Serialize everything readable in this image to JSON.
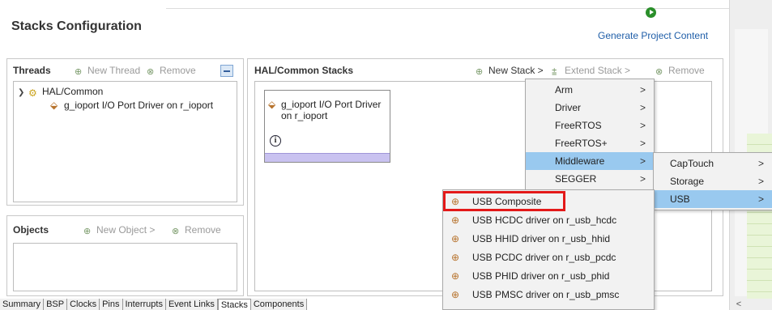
{
  "page": {
    "title": "Stacks Configuration"
  },
  "actions": {
    "generate_label": "Generate Project Content"
  },
  "threads": {
    "title": "Threads",
    "new_thread": "New Thread",
    "remove": "Remove",
    "tree": {
      "root": "HAL/Common",
      "child": "g_ioport I/O Port Driver on r_ioport"
    }
  },
  "objects": {
    "title": "Objects",
    "new_object": "New Object >",
    "remove": "Remove"
  },
  "stacks": {
    "title": "HAL/Common Stacks",
    "new_stack": "New Stack >",
    "extend_stack": "Extend Stack >",
    "remove": "Remove",
    "card_text": "g_ioport I/O Port Driver on r_ioport"
  },
  "menu_level1": {
    "items": [
      "Arm",
      "Driver",
      "FreeRTOS",
      "FreeRTOS+",
      "Middleware",
      "SEGGER"
    ],
    "selected": "Middleware"
  },
  "menu_level2": {
    "items": [
      "CapTouch",
      "Storage",
      "USB"
    ],
    "selected": "USB"
  },
  "menu_level3": {
    "items": [
      "USB Composite",
      "USB HCDC driver on r_usb_hcdc",
      "USB HHID driver on r_usb_hhid",
      "USB PCDC driver on r_usb_pcdc",
      "USB PHID driver on r_usb_phid",
      "USB PMSC driver on r_usb_pmsc"
    ],
    "highlighted": "USB Composite"
  },
  "tabs": [
    "Summary",
    "BSP",
    "Clocks",
    "Pins",
    "Interrupts",
    "Event Links",
    "Stacks",
    "Components"
  ],
  "active_tab": "Stacks",
  "colors": {
    "highlight": "#e31919",
    "menu_selection": "#99c9ef",
    "link": "#1f5ea8",
    "card_bar": "#c9c2f0"
  },
  "icons": {
    "generate": "play-circle-icon",
    "new": "add-icon",
    "remove": "remove-icon",
    "collapse": "collapse-icon",
    "module": "module-icon",
    "info": "info-icon"
  }
}
